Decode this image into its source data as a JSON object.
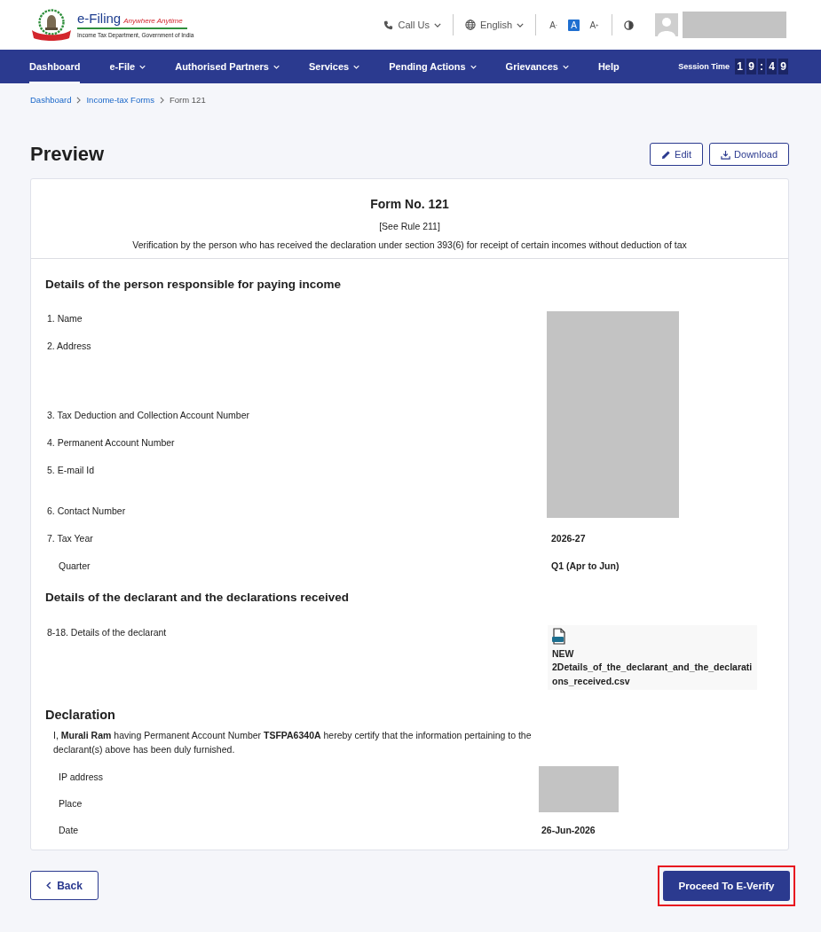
{
  "header": {
    "logo": {
      "title": "e-Filing",
      "tagline": "Anywhere Anytime",
      "subtitle": "Income Tax Department, Government of India"
    },
    "call_us": "Call Us",
    "language": "English",
    "font_size_buttons": [
      {
        "label": "A$^{-}$",
        "selected": false
      },
      {
        "label": "A",
        "selected": true
      },
      {
        "label": "A$^{+}$",
        "selected": false
      }
    ]
  },
  "nav": {
    "items": [
      {
        "label": "Dashboard",
        "selected": true,
        "has_menu": false
      },
      {
        "label": "e-File",
        "selected": false,
        "has_menu": true
      },
      {
        "label": "Authorised Partners",
        "selected": false,
        "has_menu": true
      },
      {
        "label": "Services",
        "selected": false,
        "has_menu": true
      },
      {
        "label": "Pending Actions",
        "selected": false,
        "has_menu": true
      },
      {
        "label": "Grievances",
        "selected": false,
        "has_menu": true
      },
      {
        "label": "Help",
        "selected": false,
        "has_menu": false
      }
    ],
    "session_time": {
      "label": "Session Time",
      "digits": [
        {
          "char": "1",
          "kind": "digit"
        },
        {
          "char": "9",
          "kind": "digit"
        },
        {
          "char": ":",
          "kind": "separator"
        },
        {
          "char": "4",
          "kind": "digit"
        },
        {
          "char": "9",
          "kind": "digit"
        }
      ]
    }
  },
  "breadcrumb": [
    {
      "label": "Dashboard",
      "current": false
    },
    {
      "label": "Income-tax Forms",
      "current": false
    },
    {
      "label": "Form 121",
      "current": true
    }
  ],
  "page": {
    "title": "Preview",
    "actions": [
      {
        "label": "Edit",
        "kind": "edit"
      },
      {
        "label": "Download",
        "kind": "download"
      }
    ]
  },
  "form": {
    "title": "Form No. 121",
    "rule": "[See Rule 211]",
    "description": "Verification by the person who has received the declaration under section 393(6) for receipt of certain incomes without deduction of tax",
    "payer_section": {
      "heading": "Details of the person responsible for paying income",
      "fields": [
        {
          "label": "1. Name",
          "kind": "field"
        },
        {
          "label": "2. Address",
          "kind": "field"
        },
        {
          "label": "3. Tax Deduction and Collection Account Number",
          "kind": "field"
        },
        {
          "label": "4. Permanent Account Number",
          "kind": "field"
        },
        {
          "label": "5. E-mail Id",
          "kind": "field"
        },
        {
          "label": "6. Contact Number",
          "kind": "field"
        },
        {
          "label": "7. Tax Year",
          "kind": "field",
          "value": "2026-27"
        },
        {
          "label": "Quarter",
          "kind": "sub",
          "value": "Q1 (Apr to Jun)"
        }
      ]
    },
    "declarant_section": {
      "heading": "Details of the declarant and the declarations received",
      "label": "8-18. Details of the declarant",
      "attachment": {
        "name": "NEW 2Details_of_the_declarant_and_the_declarations_received.csv"
      }
    },
    "declaration": {
      "heading": "Declaration",
      "statement": "I, **Murali Ram** having Permanent Account Number **TSFPA6340A** hereby certify that the information pertaining to the declarant(s) above has been duly furnished.",
      "fields": [
        {
          "label": "IP address"
        },
        {
          "label": "Place"
        },
        {
          "label": "Date",
          "value": "26-Jun-2026"
        }
      ]
    }
  },
  "footer_actions": {
    "back": "Back",
    "proceed": {
      "label": "Proceed To E-Verify",
      "highlighted": true
    }
  }
}
